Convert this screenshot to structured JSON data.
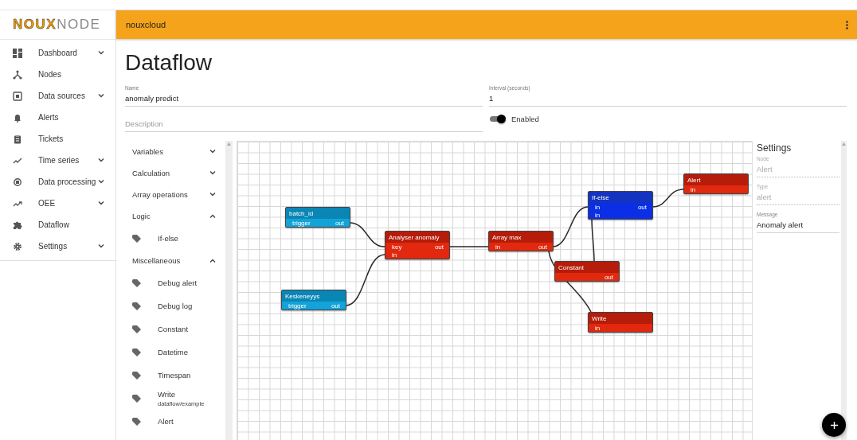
{
  "logo": {
    "bold": "NOUX",
    "light": "NODE"
  },
  "header": {
    "title": "nouxcloud"
  },
  "sidebar": {
    "items": [
      {
        "label": "Dashboard",
        "expanded": false
      },
      {
        "label": "Nodes"
      },
      {
        "label": "Data sources",
        "expanded": false
      },
      {
        "label": "Alerts"
      },
      {
        "label": "Tickets"
      },
      {
        "label": "Time series",
        "expanded": false
      },
      {
        "label": "Data processing",
        "expanded": false
      },
      {
        "label": "OEE",
        "expanded": false
      },
      {
        "label": "Dataflow"
      },
      {
        "label": "Settings",
        "expanded": false
      }
    ]
  },
  "page": {
    "title": "Dataflow"
  },
  "form": {
    "name": {
      "label": "Name",
      "value": "anomaly predict"
    },
    "interval": {
      "label": "Interval (seconds)",
      "value": "1"
    },
    "description": {
      "placeholder": "Description"
    },
    "enabled": {
      "label": "Enabled",
      "on": true
    }
  },
  "palette": [
    {
      "label": "Variables",
      "expanded": false
    },
    {
      "label": "Calculation",
      "expanded": false
    },
    {
      "label": "Array operations",
      "expanded": false
    },
    {
      "label": "Logic",
      "expanded": true,
      "children": [
        {
          "label": "If-else"
        }
      ]
    },
    {
      "label": "Miscellaneous",
      "expanded": true,
      "children": [
        {
          "label": "Debug alert"
        },
        {
          "label": "Debug log"
        },
        {
          "label": "Constant"
        },
        {
          "label": "Datetime"
        },
        {
          "label": "Timespan"
        },
        {
          "label": "Write",
          "sublabel": "dataflow/example"
        },
        {
          "label": "Alert"
        }
      ]
    }
  ],
  "canvas": {
    "nodes": [
      {
        "title": "batch_id",
        "kind": "source",
        "ports": [
          {
            "in": "trigger",
            "out": "out"
          }
        ]
      },
      {
        "title": "Keskeneyys",
        "kind": "source",
        "ports": [
          {
            "in": "trigger",
            "out": "out"
          }
        ]
      },
      {
        "title": "Analyser anomaly",
        "kind": "function",
        "ports": [
          {
            "in": "key",
            "out": "out"
          },
          {
            "in": "in"
          }
        ]
      },
      {
        "title": "Array max",
        "kind": "function",
        "ports": [
          {
            "in": "in",
            "out": "out"
          }
        ]
      },
      {
        "title": "If-else",
        "kind": "logic",
        "ports": [
          {
            "in": "in",
            "out": "out"
          },
          {
            "in": "in"
          }
        ]
      },
      {
        "title": "Alert",
        "kind": "function",
        "ports": [
          {
            "in": "in"
          }
        ]
      },
      {
        "title": "Constant",
        "kind": "function",
        "ports": [
          {
            "out": "out"
          }
        ]
      },
      {
        "title": "Write",
        "kind": "function",
        "ports": [
          {
            "in": "in"
          }
        ]
      }
    ]
  },
  "settings": {
    "title": "Settings",
    "fields": [
      {
        "label": "Node",
        "value": "Alert",
        "disabled": true
      },
      {
        "label": "Type",
        "value": "alert",
        "disabled": true
      },
      {
        "label": "Message",
        "value": "Anomaly alert",
        "disabled": false
      }
    ]
  }
}
